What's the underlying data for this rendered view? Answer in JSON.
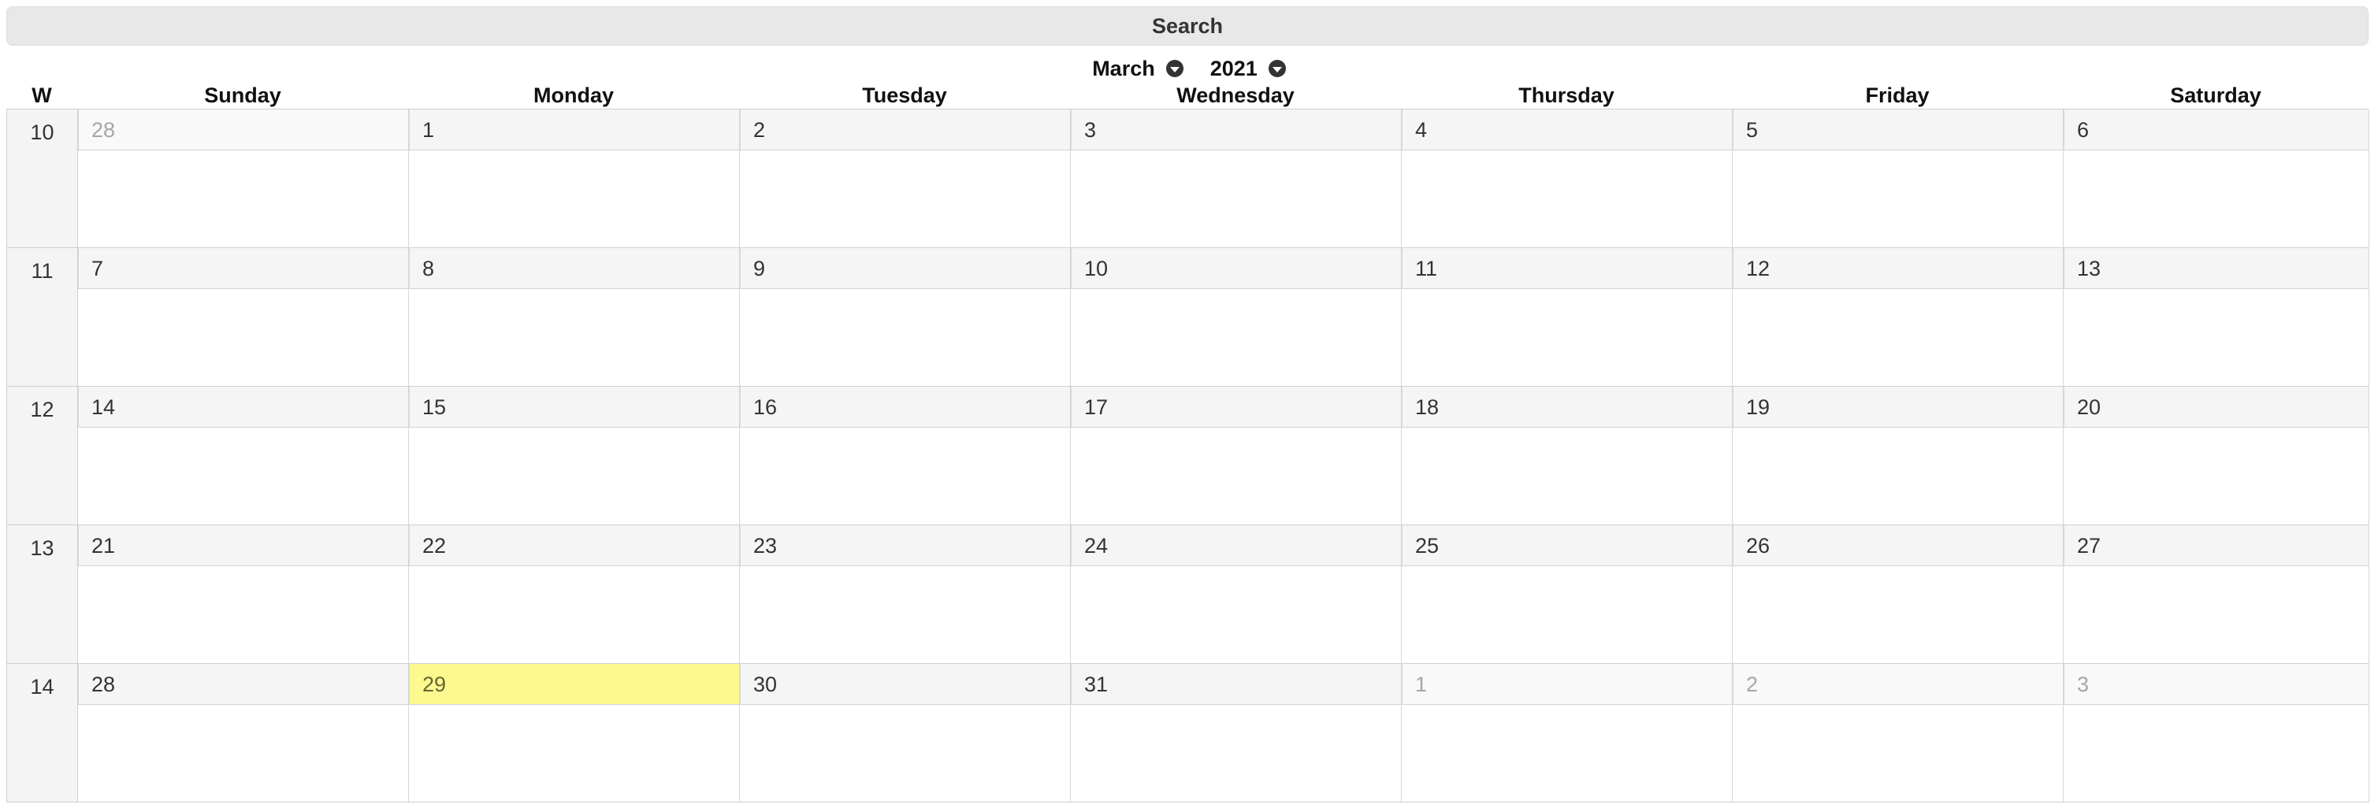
{
  "search": {
    "label": "Search"
  },
  "month": {
    "selected": "March"
  },
  "year": {
    "selected": "2021"
  },
  "colors": {
    "today_highlight": "#fdf98f",
    "header_bar": "#e8e8e8",
    "muted_text": "#a6a6a6"
  },
  "week_header": "W",
  "weekdays": [
    "Sunday",
    "Monday",
    "Tuesday",
    "Wednesday",
    "Thursday",
    "Friday",
    "Saturday"
  ],
  "weeks": [
    {
      "num": "10",
      "days": [
        {
          "d": "28",
          "muted": true
        },
        {
          "d": "1"
        },
        {
          "d": "2"
        },
        {
          "d": "3"
        },
        {
          "d": "4"
        },
        {
          "d": "5"
        },
        {
          "d": "6"
        }
      ]
    },
    {
      "num": "11",
      "days": [
        {
          "d": "7"
        },
        {
          "d": "8"
        },
        {
          "d": "9"
        },
        {
          "d": "10"
        },
        {
          "d": "11"
        },
        {
          "d": "12"
        },
        {
          "d": "13"
        }
      ]
    },
    {
      "num": "12",
      "days": [
        {
          "d": "14"
        },
        {
          "d": "15"
        },
        {
          "d": "16"
        },
        {
          "d": "17"
        },
        {
          "d": "18"
        },
        {
          "d": "19"
        },
        {
          "d": "20"
        }
      ]
    },
    {
      "num": "13",
      "days": [
        {
          "d": "21"
        },
        {
          "d": "22"
        },
        {
          "d": "23"
        },
        {
          "d": "24"
        },
        {
          "d": "25"
        },
        {
          "d": "26"
        },
        {
          "d": "27"
        }
      ]
    },
    {
      "num": "14",
      "days": [
        {
          "d": "28"
        },
        {
          "d": "29",
          "today": true
        },
        {
          "d": "30"
        },
        {
          "d": "31"
        },
        {
          "d": "1",
          "muted": true
        },
        {
          "d": "2",
          "muted": true
        },
        {
          "d": "3",
          "muted": true
        }
      ]
    }
  ]
}
